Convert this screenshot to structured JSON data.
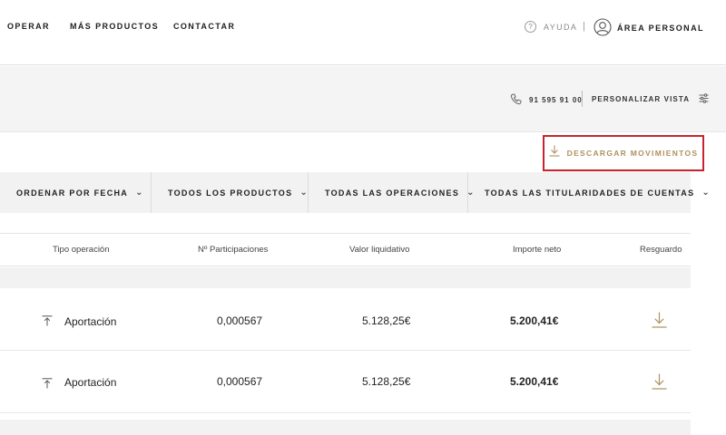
{
  "nav": {
    "items": [
      "OPERAR",
      "MÁS PRODUCTOS",
      "CONTACTAR"
    ],
    "help_label": "AYUDA",
    "separator": "|",
    "account_label": "ÁREA PERSONAL"
  },
  "toolbar": {
    "phone": "91 595 91 00",
    "customize_label": "PERSONALIZAR VISTA"
  },
  "download": {
    "label": "DESCARGAR MOVIMIENTOS"
  },
  "filters": [
    "ORDENAR POR FECHA",
    "TODOS LOS PRODUCTOS",
    "TODAS LAS OPERACIONES",
    "TODAS LAS TITULARIDADES DE CUENTAS"
  ],
  "table": {
    "headers": [
      "Tipo operación",
      "Nº Participaciones",
      "Valor liquidativo",
      "Importe neto",
      "Resguardo"
    ],
    "rows": [
      {
        "type": "Aportación",
        "units": "0,000567",
        "nav_value": "5.128,25€",
        "net_amount": "5.200,41€"
      },
      {
        "type": "Aportación",
        "units": "0,000567",
        "nav_value": "5.128,25€",
        "net_amount": "5.200,41€"
      }
    ]
  },
  "colors": {
    "accent": "#b0905e",
    "highlight_border": "#c8232c",
    "band_bg": "#f4f4f4"
  },
  "icons": [
    "help-icon",
    "user-icon",
    "phone-icon",
    "settings-sliders-icon",
    "download-icon",
    "upload-icon"
  ]
}
